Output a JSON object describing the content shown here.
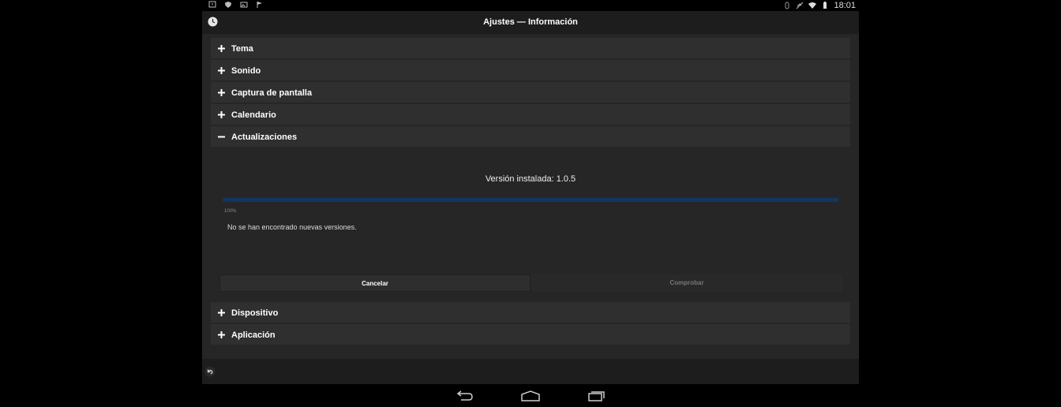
{
  "status_bar": {
    "time": "18:01",
    "left_icons": [
      "notification-icon",
      "shield-icon",
      "image-icon",
      "flag-icon"
    ],
    "right_icons": [
      "bluetooth-icon",
      "mute-icon",
      "wifi-icon",
      "battery-icon"
    ]
  },
  "header": {
    "title": "Ajustes — Información",
    "left_icon": "clock-icon"
  },
  "sections_top": [
    {
      "label": "Tema",
      "state": "collapsed"
    },
    {
      "label": "Sonido",
      "state": "collapsed"
    },
    {
      "label": "Captura de pantalla",
      "state": "collapsed"
    },
    {
      "label": "Calendario",
      "state": "collapsed"
    },
    {
      "label": "Actualizaciones",
      "state": "expanded"
    }
  ],
  "updates": {
    "installed_version": "Versión instalada: 1.0.5",
    "progress_percent": 100,
    "progress_label": "100%",
    "message": "No se han encontrado nuevas versiones.",
    "cancel_label": "Cancelar",
    "check_label": "Comprobar"
  },
  "sections_bottom": [
    {
      "label": "Dispositivo",
      "state": "collapsed"
    },
    {
      "label": "Aplicación",
      "state": "collapsed"
    }
  ],
  "footer": {
    "left_icon": "undo-icon"
  },
  "nav": {
    "icons": [
      "back-icon",
      "home-icon",
      "recents-icon"
    ]
  },
  "colors": {
    "background": "#262626",
    "section": "#2f2f2f",
    "progress_fill": "#13365f"
  }
}
